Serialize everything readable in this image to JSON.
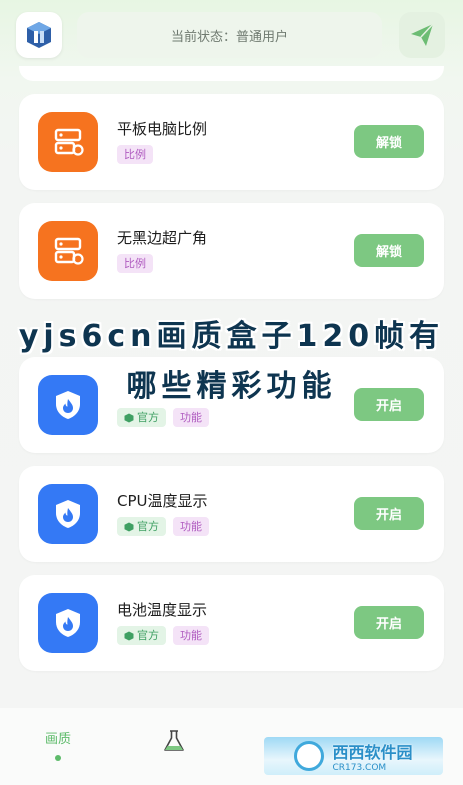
{
  "header": {
    "status_text": "当前状态：普通用户",
    "logo_icon": "app-logo-icon",
    "send_icon": "paper-plane-icon"
  },
  "cards": [
    {
      "title": "平板电脑比例",
      "icon": "server-cog-icon",
      "tags": [
        "比例"
      ],
      "action": "解锁"
    },
    {
      "title": "无黑边超广角",
      "icon": "server-cog-icon",
      "tags": [
        "比例"
      ],
      "action": "解锁"
    },
    {
      "title": "",
      "icon": "shield-flame-icon",
      "tags": [
        "官方",
        "功能"
      ],
      "action": "开启"
    },
    {
      "title": "CPU温度显示",
      "icon": "shield-flame-icon",
      "tags": [
        "官方",
        "功能"
      ],
      "action": "开启"
    },
    {
      "title": "电池温度显示",
      "icon": "shield-flame-icon",
      "tags": [
        "官方",
        "功能"
      ],
      "action": "开启"
    }
  ],
  "overlay": {
    "line1": "yjs6cn画质盒子120帧有",
    "line2": "哪些精彩功能"
  },
  "bottom_nav": {
    "items": [
      {
        "label": "画质",
        "active": true
      },
      {
        "icon": "flask-icon"
      }
    ]
  },
  "watermark": {
    "text": "西西软件园",
    "sub": "CR173.COM"
  },
  "colors": {
    "accent_green": "#7dc882",
    "orange": "#f6731f",
    "blue": "#3479f5"
  }
}
